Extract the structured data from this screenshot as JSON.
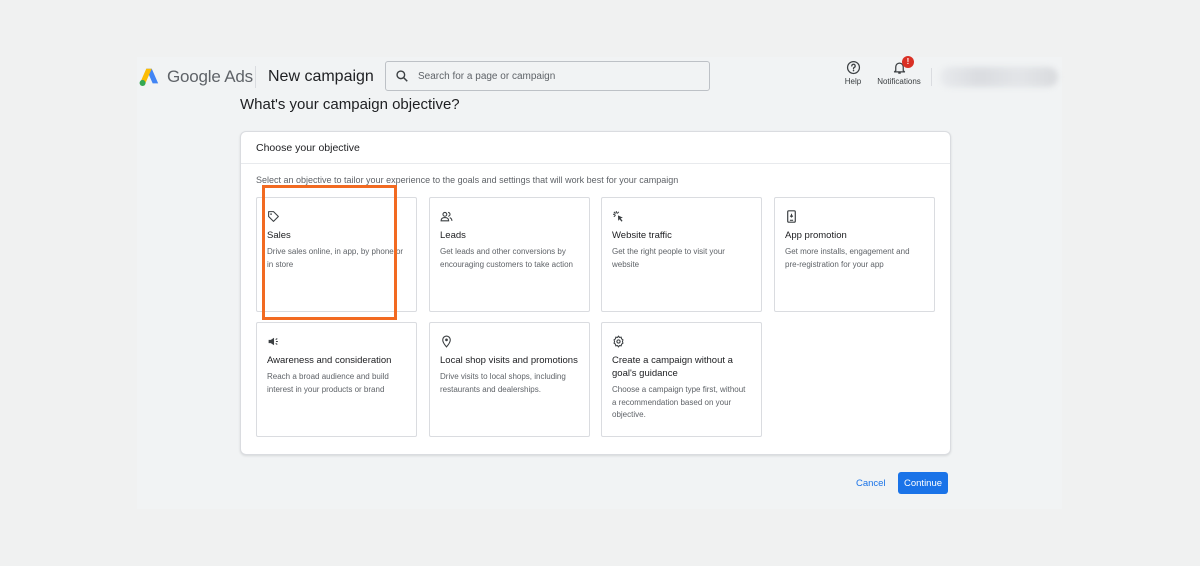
{
  "header": {
    "brand": "Google Ads",
    "page_title": "New campaign",
    "search_placeholder": "Search for a page or campaign",
    "help_label": "Help",
    "notifications_label": "Notifications",
    "notifications_badge": "!"
  },
  "main": {
    "question": "What's your campaign objective?",
    "panel_title": "Choose your objective",
    "instruction": "Select an objective to tailor your experience to the goals and settings that will work best for your campaign",
    "objectives": [
      {
        "icon": "tag-icon",
        "title": "Sales",
        "description": "Drive sales online, in app, by phone or in store",
        "selected": true
      },
      {
        "icon": "people-icon",
        "title": "Leads",
        "description": "Get leads and other conversions by encouraging customers to take action"
      },
      {
        "icon": "click-icon",
        "title": "Website traffic",
        "description": "Get the right people to visit your website"
      },
      {
        "icon": "phone-icon",
        "title": "App promotion",
        "description": "Get more installs, engagement and pre-registration for your app"
      },
      {
        "icon": "megaphone-icon",
        "title": "Awareness and consideration",
        "description": "Reach a broad audience and build interest in your products or brand"
      },
      {
        "icon": "location-pin-icon",
        "title": "Local shop visits and promotions",
        "description": "Drive visits to local shops, including restaurants and dealerships."
      },
      {
        "icon": "gear-icon",
        "title": "Create a campaign without a goal's guidance",
        "description": "Choose a campaign type first, without a recommendation based on your objective."
      }
    ]
  },
  "footer": {
    "cancel_label": "Cancel",
    "continue_label": "Continue"
  },
  "colors": {
    "accent": "#1a73e8",
    "highlight": "#f26a21",
    "badge": "#d93025"
  }
}
